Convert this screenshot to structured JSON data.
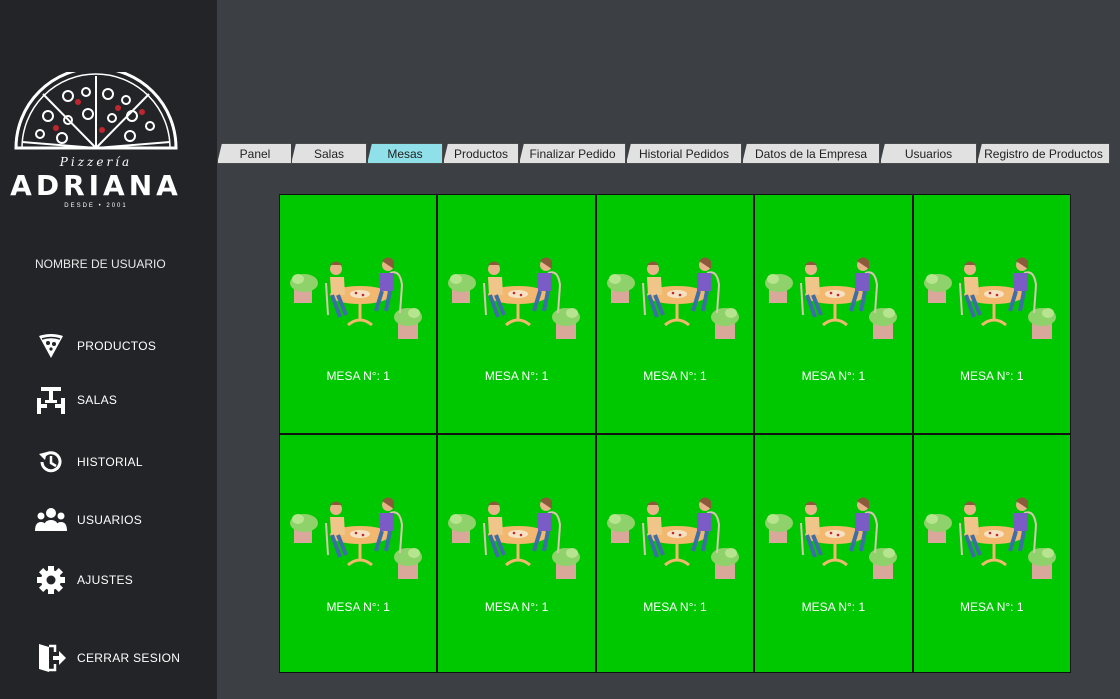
{
  "brand": {
    "top": "Pizzería",
    "name": "ADRIANA",
    "since": "DESDE • 2001"
  },
  "user": {
    "name": "NOMBRE DE USUARIO"
  },
  "nav": [
    {
      "label": "PRODUCTOS",
      "icon": "pizza-icon"
    },
    {
      "label": "SALAS",
      "icon": "table-icon"
    },
    {
      "label": "HISTORIAL",
      "icon": "history-icon"
    },
    {
      "label": "USUARIOS",
      "icon": "users-icon"
    },
    {
      "label": "AJUSTES",
      "icon": "gear-icon"
    },
    {
      "label": "CERRAR SESION",
      "icon": "logout-icon"
    }
  ],
  "tabs": [
    {
      "label": "Panel"
    },
    {
      "label": "Salas"
    },
    {
      "label": "Mesas",
      "active": true
    },
    {
      "label": "Productos"
    },
    {
      "label": "Finalizar Pedido"
    },
    {
      "label": "Historial Pedidos"
    },
    {
      "label": "Datos de la Empresa"
    },
    {
      "label": "Usuarios"
    },
    {
      "label": "Registro de Productos"
    }
  ],
  "mesas": [
    {
      "label": "MESA N°: 1"
    },
    {
      "label": "MESA N°: 1"
    },
    {
      "label": "MESA N°: 1"
    },
    {
      "label": "MESA N°: 1"
    },
    {
      "label": "MESA N°: 1"
    },
    {
      "label": "MESA N°: 1"
    },
    {
      "label": "MESA N°: 1"
    },
    {
      "label": "MESA N°: 1"
    },
    {
      "label": "MESA N°: 1"
    },
    {
      "label": "MESA N°: 1"
    }
  ],
  "colors": {
    "sidebar": "#222428",
    "background": "#3c3f43",
    "mesa_free": "#00c800",
    "tab_active": "#8fe0e8",
    "tab": "#e1e1e1"
  }
}
